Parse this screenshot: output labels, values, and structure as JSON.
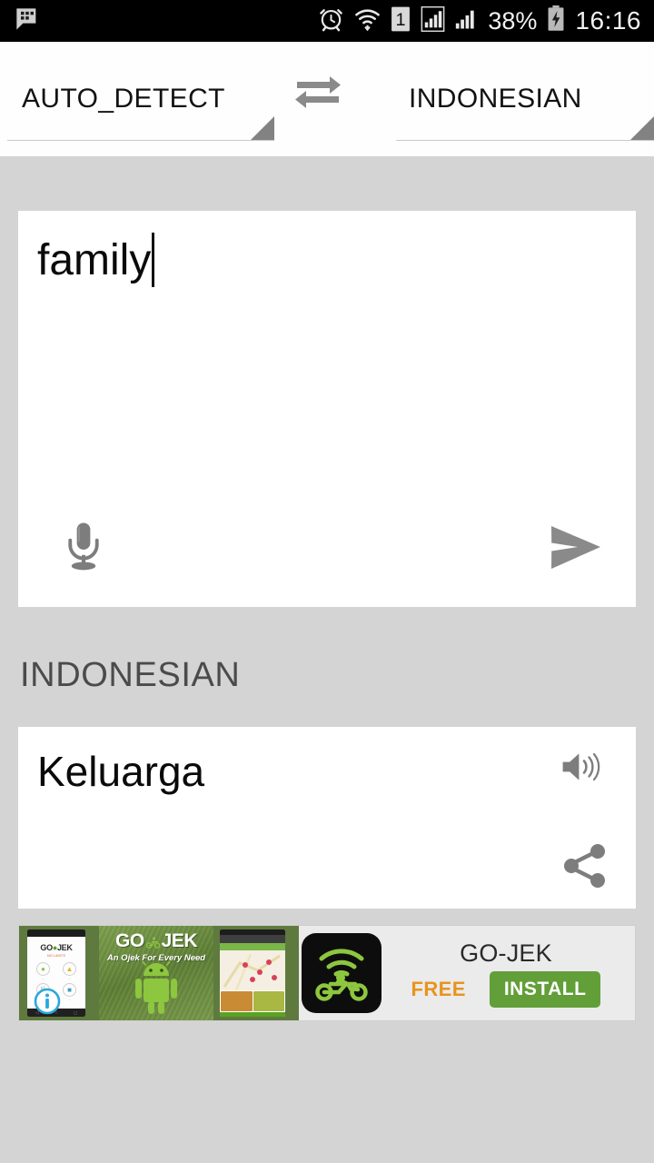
{
  "statusbar": {
    "time": "16:16",
    "battery_percent": "38%",
    "icons": [
      "bbm-message-icon",
      "alarm-clock-icon",
      "wifi-icon",
      "sim1-icon",
      "signal-bars-icon",
      "signal-bars-2-icon",
      "battery-charging-icon"
    ]
  },
  "langbar": {
    "source_language": "AUTO_DETECT",
    "target_language": "INDONESIAN",
    "swap_icon": "swap-arrows-icon"
  },
  "input": {
    "text": "family",
    "mic_icon": "microphone-icon",
    "send_icon": "send-icon"
  },
  "result": {
    "language_label": "INDONESIAN",
    "translation": "Keluarga",
    "speaker_icon": "speaker-icon",
    "share_icon": "share-icon"
  },
  "ad": {
    "app_name": "GO-JEK",
    "price_label": "FREE",
    "install_label": "INSTALL",
    "banner_title": "GO JEK",
    "banner_tagline": "An Ojek For Every Need",
    "thumb_logo": "GO JEK",
    "thumb_logo_sub": "NO LIMITS",
    "adchoices_icon": "adchoices-info-icon",
    "app_icon": "gojek-motorbike-icon"
  },
  "colors": {
    "background": "#d4d4d4",
    "card": "#ffffff",
    "statusbar": "#000000",
    "accent_green": "#629f38",
    "accent_orange": "#e8941d",
    "text_primary": "#0a0a0a",
    "text_secondary": "#4b4b4b",
    "icon_gray": "#808080"
  }
}
